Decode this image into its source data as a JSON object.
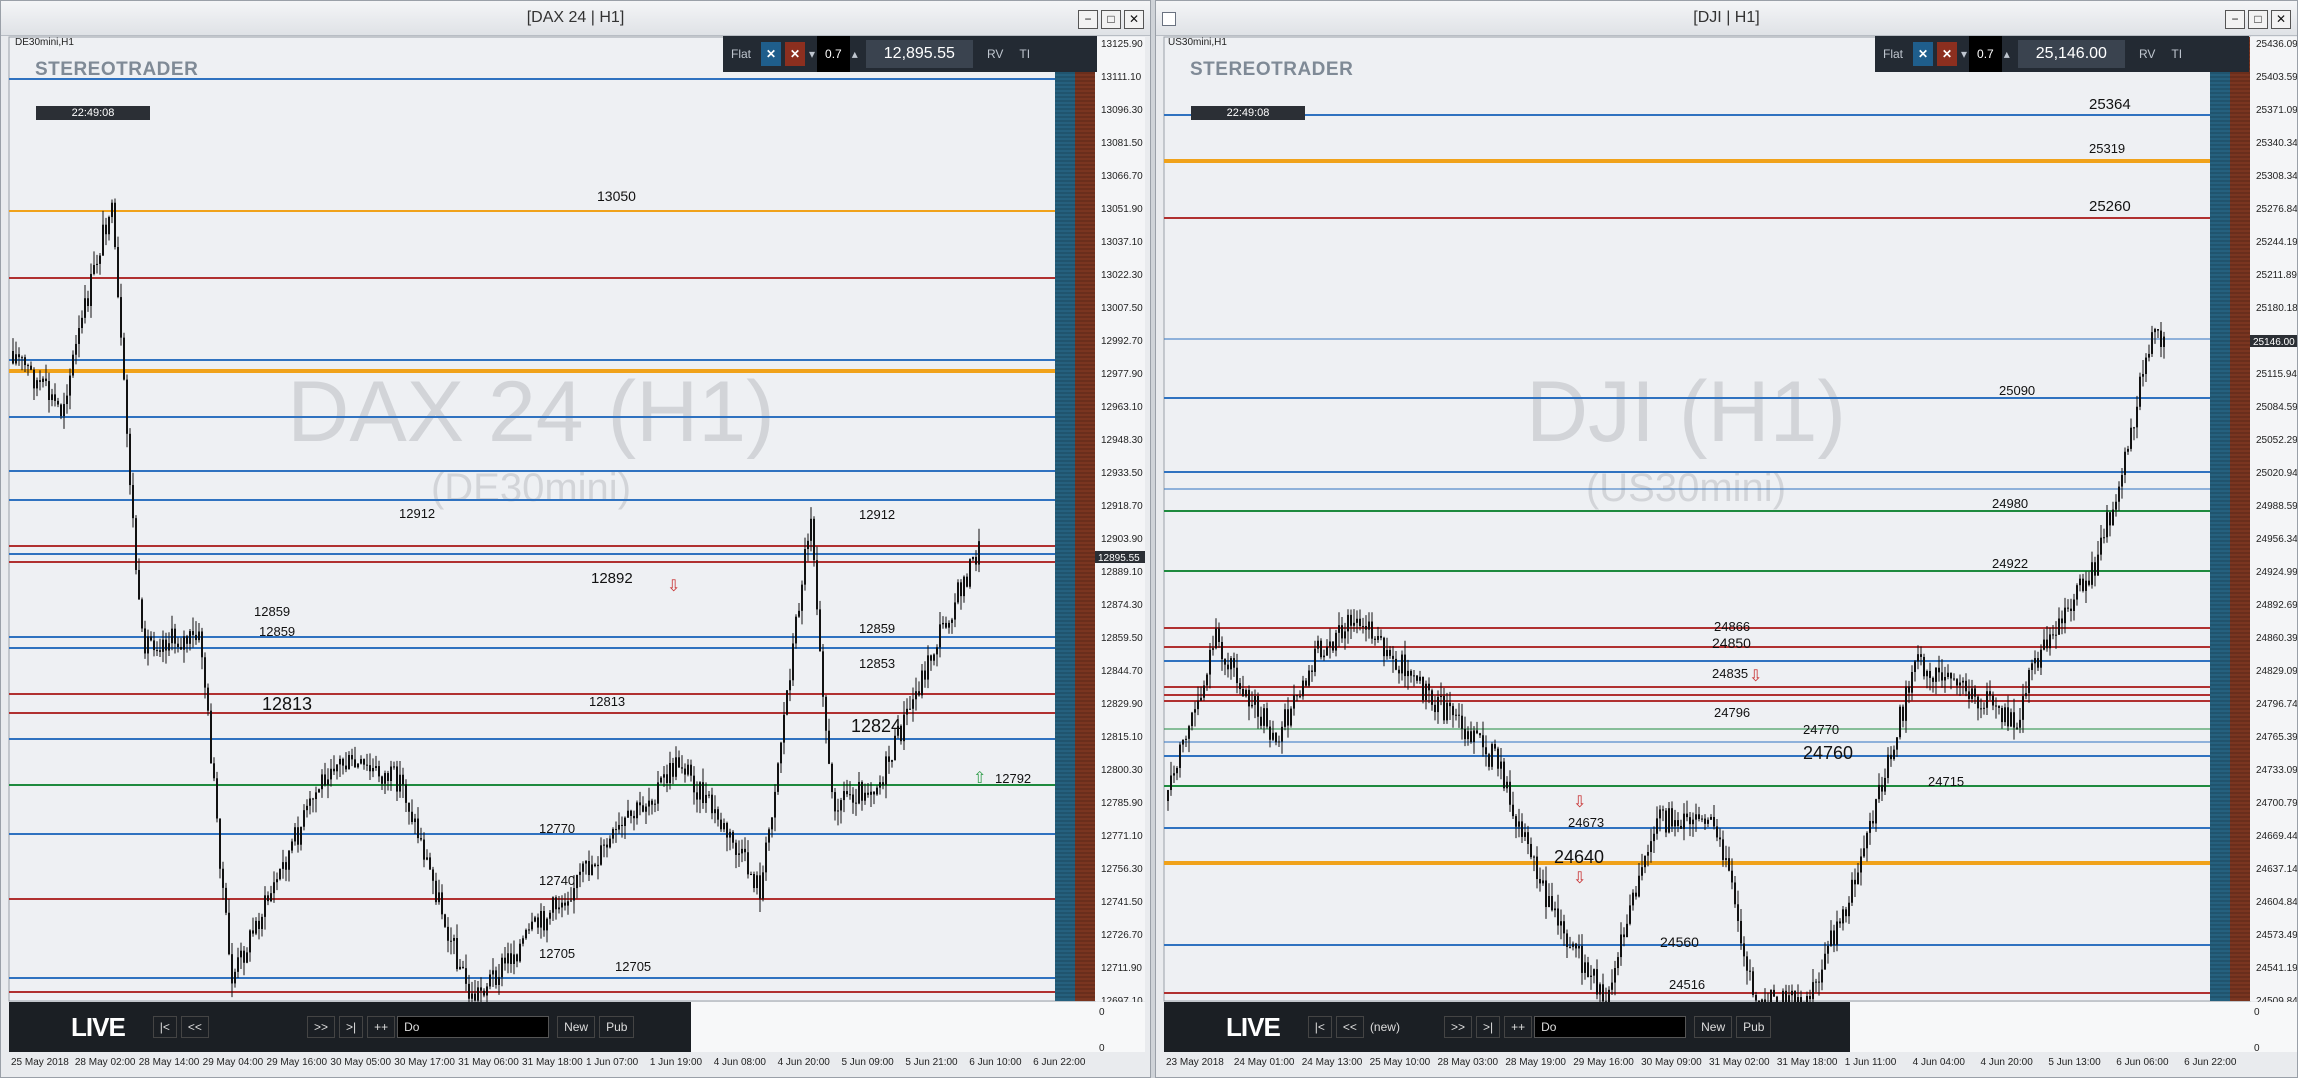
{
  "colors": {
    "blue": "#2f72c0",
    "orange": "#f0a21a",
    "red": "#b03030",
    "green": "#1e8a3e",
    "candle": "#111111",
    "watermark": "#d2d4d8"
  },
  "left": {
    "title": "[DAX 24 | H1]",
    "symbol": "DE30mini,H1",
    "logo": "STEREOTRADER",
    "clock": "22:49:08",
    "toolbar": {
      "flat": "Flat",
      "mult": "0.7",
      "price": "12,895.55",
      "rv": "RV",
      "ti": "TI"
    },
    "watermark_title": "DAX 24 (H1)",
    "watermark_sub": "(DE30mini)",
    "y_labels": [
      "13125.90",
      "13111.10",
      "13096.30",
      "13081.50",
      "13066.70",
      "13051.90",
      "13037.10",
      "13022.30",
      "13007.50",
      "12992.70",
      "12977.90",
      "12963.10",
      "12948.30",
      "12933.50",
      "12918.70",
      "12903.90",
      "12889.10",
      "12874.30",
      "12859.50",
      "12844.70",
      "12829.90",
      "12815.10",
      "12800.30",
      "12785.90",
      "12771.10",
      "12756.30",
      "12741.50",
      "12726.70",
      "12711.90",
      "12697.10"
    ],
    "current_price_label": "12895.55",
    "x_labels": [
      "25 May 2018",
      "28 May 02:00",
      "28 May 14:00",
      "29 May 04:00",
      "29 May 16:00",
      "30 May 05:00",
      "30 May 17:00",
      "31 May 06:00",
      "31 May 18:00",
      "1 Jun 07:00",
      "1 Jun 19:00",
      "4 Jun 08:00",
      "4 Jun 20:00",
      "5 Jun 09:00",
      "5 Jun 21:00",
      "6 Jun 10:00",
      "6 Jun 22:00"
    ],
    "level_labels": [
      "13050",
      "12912",
      "12912",
      "12892",
      "12859",
      "12859",
      "12859",
      "12853",
      "12813",
      "12813",
      "12824",
      "12792",
      "12770",
      "12740",
      "12705",
      "12705"
    ],
    "bottom": {
      "live": "LIVE",
      "first": "|<",
      "prev": "<<",
      "next": ">>",
      "last": ">|",
      "plus": "++",
      "input": "Do",
      "new": "New",
      "pub": "Pub"
    },
    "sub_zero": "0"
  },
  "right": {
    "title": "[DJI | H1]",
    "symbol": "US30mini,H1",
    "logo": "STEREOTRADER",
    "clock": "22:49:08",
    "toolbar": {
      "flat": "Flat",
      "mult": "0.7",
      "price": "25,146.00",
      "rv": "RV",
      "ti": "TI"
    },
    "watermark_title": "DJI (H1)",
    "watermark_sub": "(US30mini)",
    "y_labels": [
      "25436.09",
      "25403.59",
      "25371.09",
      "25340.34",
      "25308.34",
      "25276.84",
      "25244.19",
      "25211.89",
      "25180.18",
      "25146.00",
      "25115.94",
      "25084.59",
      "25052.29",
      "25020.94",
      "24988.59",
      "24956.34",
      "24924.99",
      "24892.69",
      "24860.39",
      "24829.09",
      "24796.74",
      "24765.39",
      "24733.09",
      "24700.79",
      "24669.44",
      "24637.14",
      "24604.84",
      "24573.49",
      "24541.19",
      "24509.84"
    ],
    "current_price_label": "25146.00",
    "x_labels": [
      "23 May 2018",
      "24 May 01:00",
      "24 May 13:00",
      "25 May 10:00",
      "28 May 03:00",
      "28 May 19:00",
      "29 May 16:00",
      "30 May 09:00",
      "31 May 02:00",
      "31 May 18:00",
      "1 Jun 11:00",
      "4 Jun 04:00",
      "4 Jun 20:00",
      "5 Jun 13:00",
      "6 Jun 06:00",
      "6 Jun 22:00"
    ],
    "level_labels": [
      "25364",
      "25319",
      "25260",
      "25090",
      "24980",
      "24922",
      "24866",
      "24850",
      "24835",
      "24796",
      "24770",
      "24760",
      "24715",
      "24673",
      "24640",
      "24560",
      "24516"
    ],
    "bottom": {
      "live": "LIVE",
      "first": "|<",
      "prev": "<<",
      "new_tag": "(new)",
      "next": ">>",
      "last": ">|",
      "plus": "++",
      "input": "Do",
      "new": "New",
      "pub": "Pub"
    },
    "sub_zero": "0"
  }
}
